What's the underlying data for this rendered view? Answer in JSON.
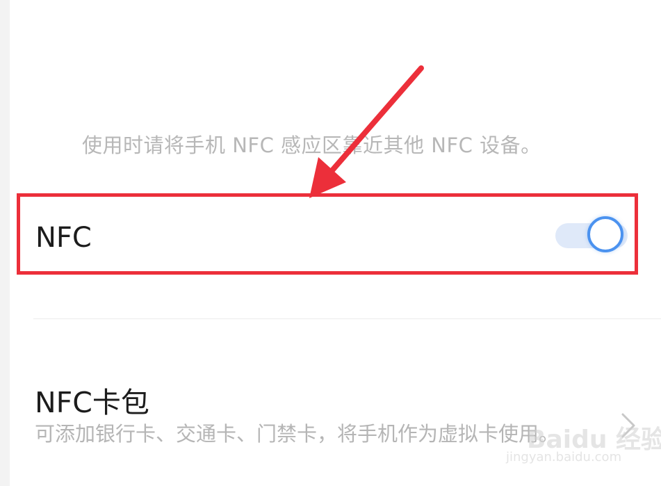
{
  "hint_text": "使用时请将手机 NFC 感应区靠近其他 NFC 设备。",
  "nfc_row": {
    "label": "NFC",
    "toggle_on": true
  },
  "wallet_row": {
    "title": "NFC卡包",
    "description": "可添加银行卡、交通卡、门禁卡，将手机作为虚拟卡使用。"
  },
  "watermark": {
    "brand": "Baidu 经验",
    "url": "jingyan.baidu.com"
  },
  "colors": {
    "highlight_border": "#ec2f3a",
    "annotation_arrow": "#ec2f3a",
    "toggle_accent": "#4b92ef",
    "toggle_track": "#dfe9f9",
    "hint_text": "#b7b7b7"
  },
  "icons": {
    "chevron": "chevron-right-icon",
    "arrow": "annotation-arrow-icon"
  }
}
